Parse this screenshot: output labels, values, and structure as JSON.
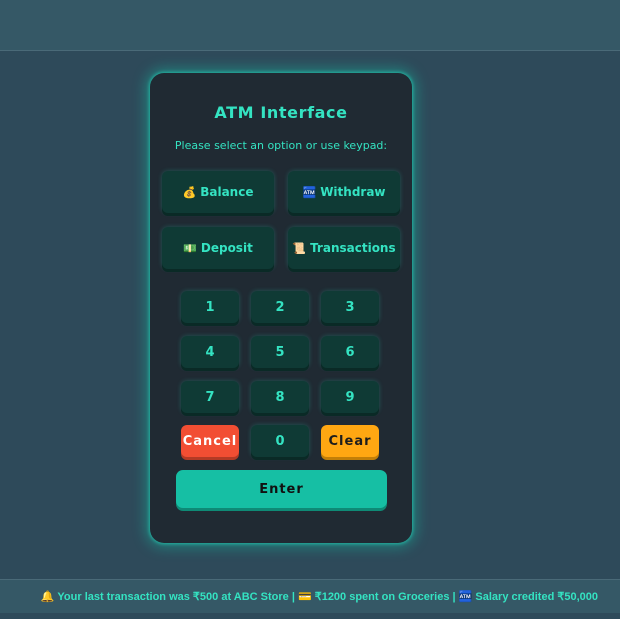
{
  "atm": {
    "title": "ATM Interface",
    "subtitle": "Please select an option or use keypad:",
    "options": [
      {
        "icon": "💰",
        "label": "Balance"
      },
      {
        "icon": "🏧",
        "label": "Withdraw"
      },
      {
        "icon": "💵",
        "label": "Deposit"
      },
      {
        "icon": "📜",
        "label": "Transactions"
      }
    ],
    "keys": [
      "1",
      "2",
      "3",
      "4",
      "5",
      "6",
      "7",
      "8",
      "9"
    ],
    "cancel": "Cancel",
    "zero": "0",
    "clear": "Clear",
    "enter": "Enter"
  },
  "ticker": {
    "text": "🔔 Your last transaction was ₹500 at ABC Store | 💳 ₹1200 spent on Groceries | 🏧 Salary credited ₹50,000"
  },
  "colors": {
    "accent": "#34e3c2",
    "background": "#2e4a5a",
    "panel": "#202a33",
    "button": "#0f3a35",
    "cancel": "#f24e33",
    "clear": "#ffa712",
    "enter": "#16bfa4"
  }
}
